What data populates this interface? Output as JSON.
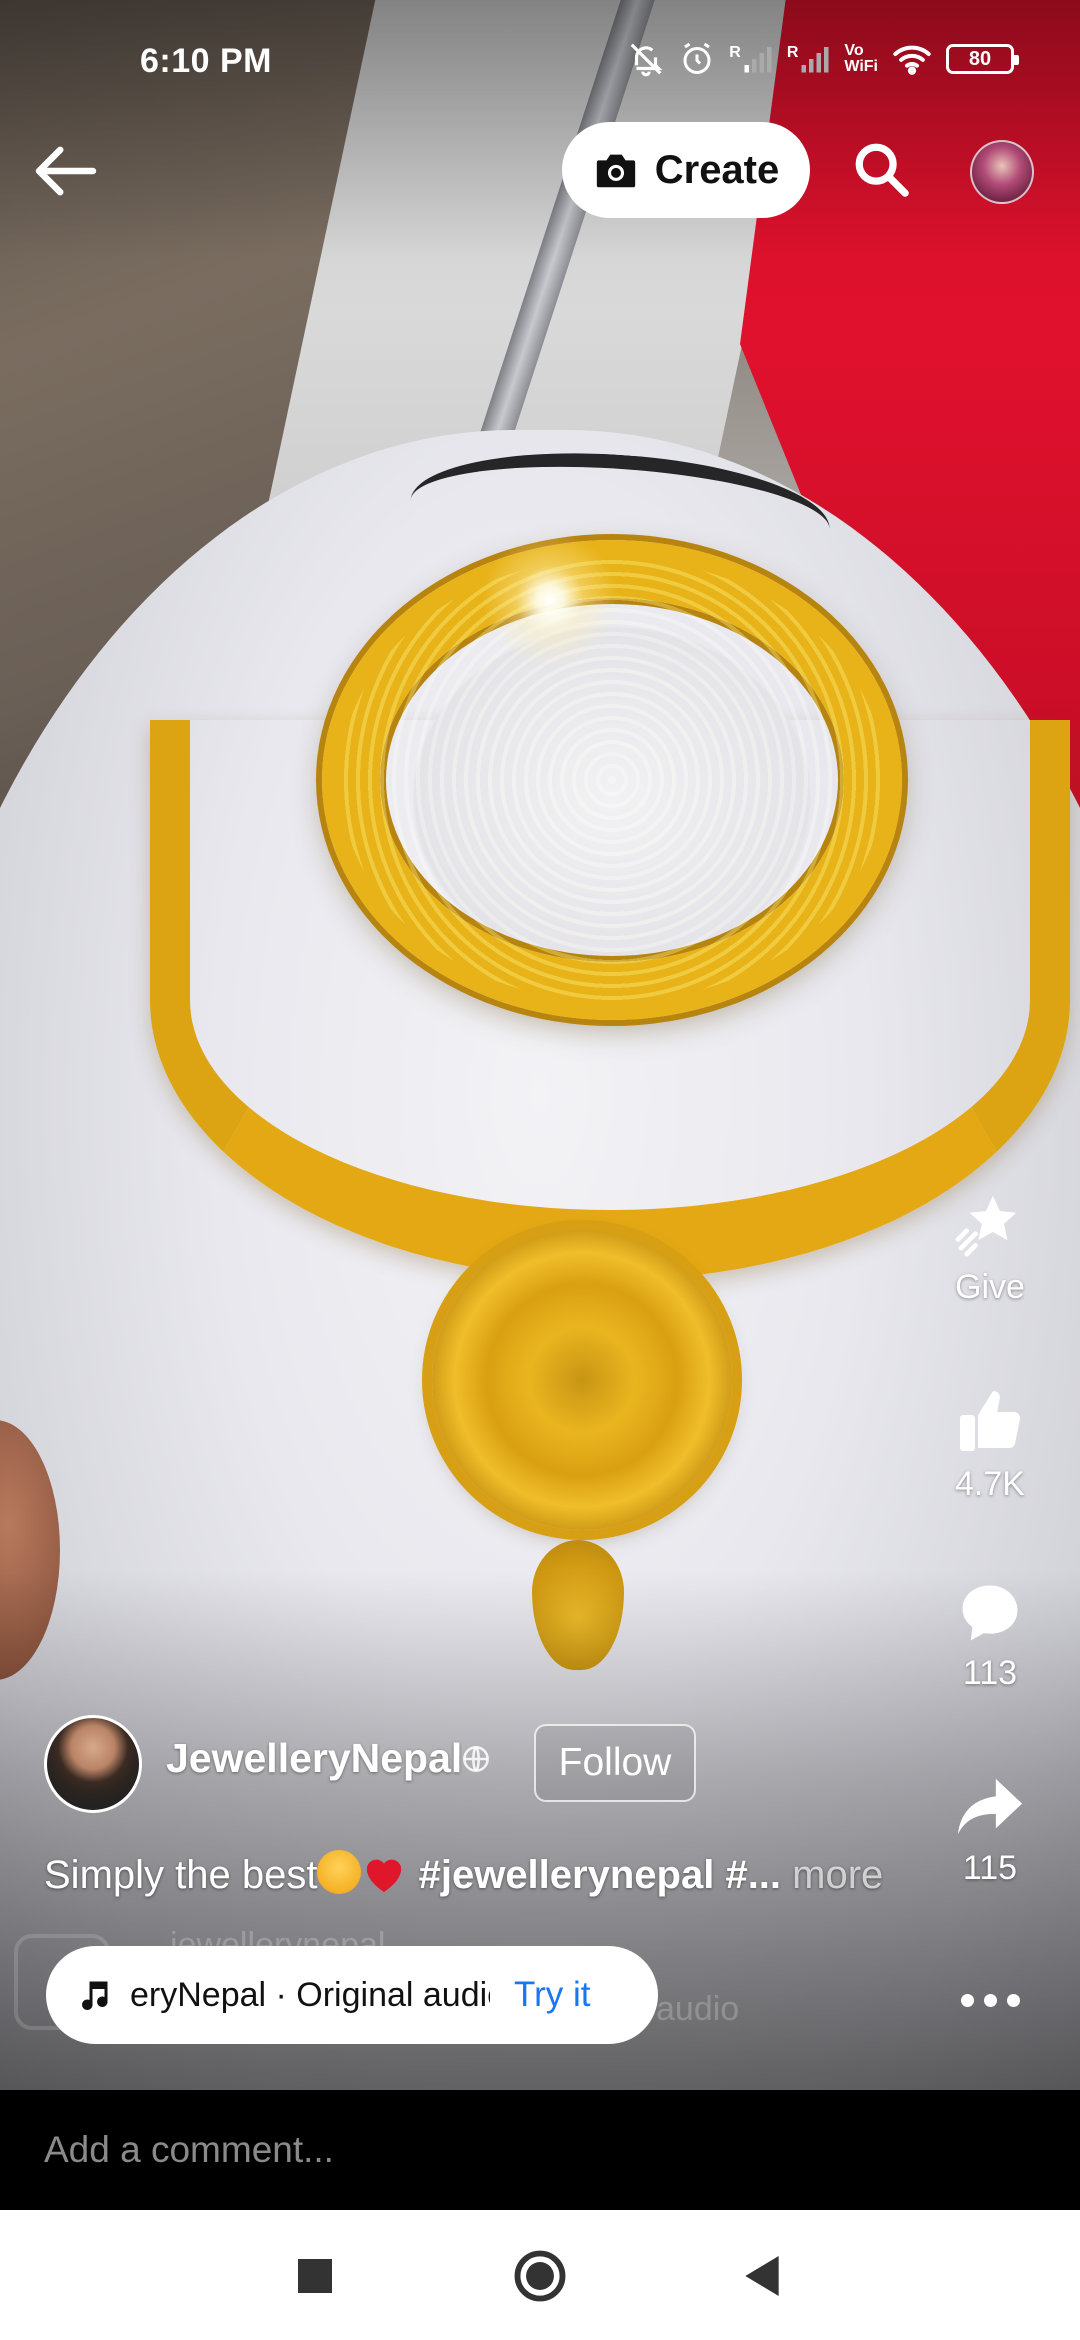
{
  "status_bar": {
    "time": "6:10 PM",
    "battery": "80",
    "icons": [
      "mute-icon",
      "alarm-icon",
      "signal-r-icon",
      "signal-r-icon",
      "vowifi-icon",
      "wifi-icon",
      "battery-icon"
    ],
    "vowifi_line1": "Vo",
    "vowifi_line2": "WiFi",
    "roaming": "R"
  },
  "top_bar": {
    "create_label": "Create"
  },
  "rail": {
    "give_label": "Give",
    "likes": "4.7K",
    "comments": "113",
    "shares": "115"
  },
  "post": {
    "author": "JewelleryNepal",
    "follow_label": "Follow",
    "caption_text": "Simply the best",
    "caption_hashtag": "#jewellerynepal",
    "caption_tail": " #...",
    "more_label": " more",
    "ghost_author": "jewellerynepal",
    "ghost_audio": "audio"
  },
  "audio": {
    "text": "eryNepal · Original audio",
    "try_label": "Try it"
  },
  "comment_bar": {
    "placeholder": "Add a comment..."
  },
  "colors": {
    "accent_blue": "#1877f2",
    "gold": "#e4a814",
    "red_panel": "#d6102a"
  }
}
